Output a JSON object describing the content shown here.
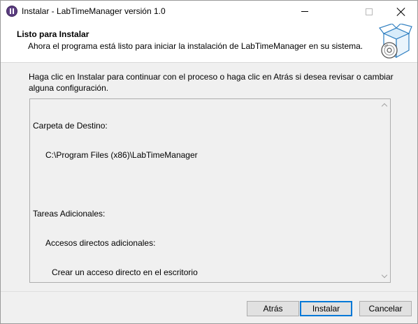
{
  "window": {
    "title": "Instalar - LabTimeManager versión 1.0",
    "icon": "labtimemanager-app-icon"
  },
  "header": {
    "title": "Listo para Instalar",
    "subtitle": "Ahora el programa está listo para iniciar la instalación de LabTimeManager en su sistema.",
    "graphic": "setup-box-disc-icon"
  },
  "instructions": "Haga clic en Instalar para continuar con el proceso o haga clic en Atrás si desea revisar o cambiar alguna configuración.",
  "summary": {
    "lines": [
      "Carpeta de Destino:",
      "C:\\Program Files (x86)\\LabTimeManager",
      "",
      "Tareas Adicionales:",
      "Accesos directos adicionales:",
      "Crear un acceso directo en el escritorio"
    ]
  },
  "buttons": {
    "back": "Atrás",
    "install": "Instalar",
    "cancel": "Cancelar"
  },
  "colors": {
    "accent": "#0078d7",
    "window_bg": "#f0f0f0",
    "header_bg": "#ffffff"
  }
}
